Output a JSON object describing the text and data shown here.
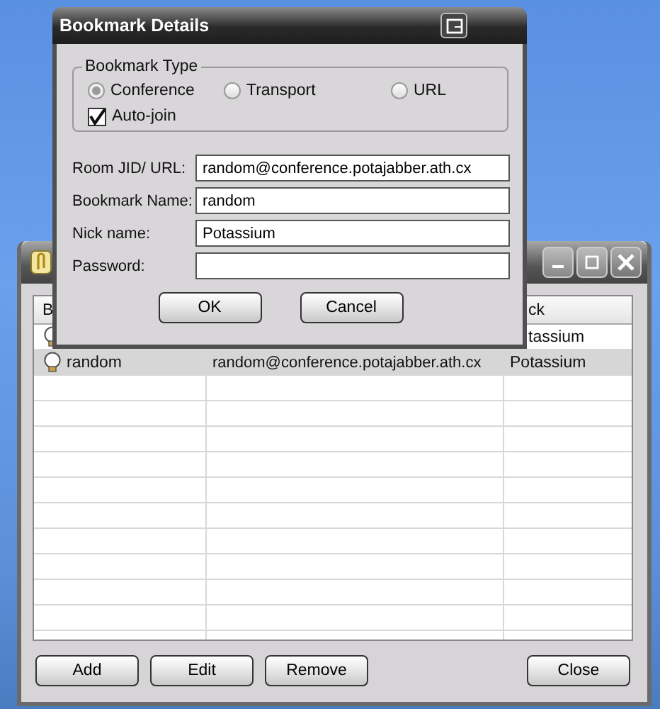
{
  "dialog": {
    "title": "Bookmark Details",
    "bookmark_type": {
      "legend": "Bookmark Type",
      "options": [
        {
          "label": "Conference",
          "selected": true
        },
        {
          "label": "Transport",
          "selected": false
        },
        {
          "label": "URL",
          "selected": false
        }
      ],
      "auto_join": {
        "label": "Auto-join",
        "checked": true
      }
    },
    "fields": [
      {
        "label": "Room JID/ URL:",
        "value": "random@conference.potajabber.ath.cx"
      },
      {
        "label": "Bookmark Name:",
        "value": "random"
      },
      {
        "label": "Nick name:",
        "value": "Potassium"
      },
      {
        "label": "Password:"
      }
    ],
    "buttons": [
      "OK",
      "Cancel"
    ]
  },
  "bookmarks_window": {
    "table": {
      "column_1_header": "B",
      "column_3_header": "ck",
      "rows": [
        {
          "nick": "tassium",
          "selected": false
        },
        {
          "name": "random",
          "jid": "random@conference.potajabber.ath.cx",
          "nick": "Potassium",
          "selected": true
        }
      ]
    },
    "buttons": [
      "Add",
      "Edit",
      "Remove",
      "Close"
    ]
  }
}
